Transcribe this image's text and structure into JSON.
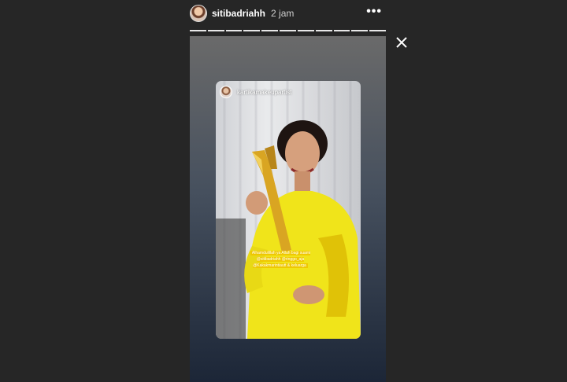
{
  "story": {
    "username": "sitibadriahh",
    "time": "2 jam",
    "segment_count": 11,
    "shared_post": {
      "username": "kartikamakeupartist",
      "caption": "Alhamdulillah ya Allah bagi suami @sitibadriahh @ringgo_aja @Kakakmarintiautt & keluarga"
    }
  },
  "icons": {
    "more": "more-options-icon",
    "close": "close-icon"
  }
}
